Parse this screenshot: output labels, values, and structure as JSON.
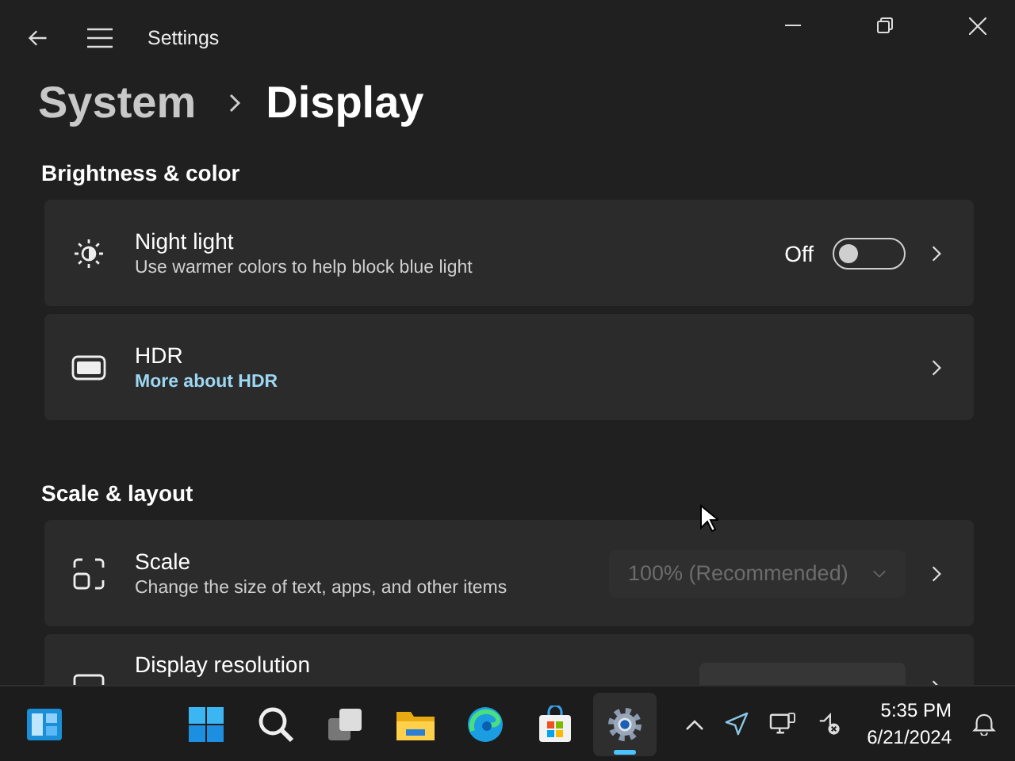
{
  "window": {
    "title": "Settings"
  },
  "breadcrumb": {
    "parent": "System",
    "current": "Display"
  },
  "sections": [
    {
      "title": "Brightness & color",
      "items": [
        {
          "kind": "toggle",
          "title": "Night light",
          "subtitle": "Use warmer colors to help block blue light",
          "state_label": "Off",
          "on": false
        },
        {
          "kind": "link",
          "title": "HDR",
          "link": "More about HDR"
        }
      ]
    },
    {
      "title": "Scale & layout",
      "items": [
        {
          "kind": "dropdown",
          "title": "Scale",
          "subtitle": "Change the size of text, apps, and other items",
          "value": "100% (Recommended)",
          "disabled": true
        },
        {
          "kind": "dropdown",
          "title": "Display resolution"
        }
      ]
    }
  ],
  "taskbar": {
    "apps": [
      {
        "selected": false
      },
      {
        "selected": false
      },
      {
        "selected": false
      },
      {
        "selected": false
      },
      {
        "selected": false
      },
      {
        "selected": false
      },
      {
        "selected": true
      }
    ],
    "time": "5:35 PM",
    "date": "6/21/2024"
  }
}
